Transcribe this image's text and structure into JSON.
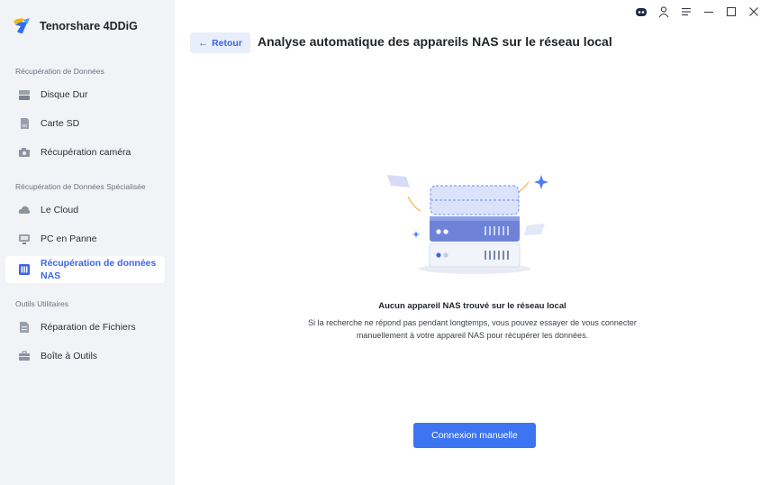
{
  "app": {
    "name": "Tenorshare 4DDiG"
  },
  "sidebar": {
    "sections": [
      {
        "title": "Récupération de Données"
      },
      {
        "title": "Récupération de Données Spécialisée"
      },
      {
        "title": "Outils Utilitaires"
      }
    ],
    "items": [
      {
        "label": "Disque Dur",
        "icon": "hard-drive-icon"
      },
      {
        "label": "Carte SD",
        "icon": "sd-card-icon"
      },
      {
        "label": "Récupération caméra",
        "icon": "camera-icon"
      },
      {
        "label": "Le Cloud",
        "icon": "cloud-icon"
      },
      {
        "label": "PC en Panne",
        "icon": "pc-icon"
      },
      {
        "label": "Récupération de données NAS",
        "icon": "nas-icon",
        "active": true
      },
      {
        "label": "Réparation de Fichiers",
        "icon": "file-repair-icon"
      },
      {
        "label": "Boîte à Outils",
        "icon": "toolbox-icon"
      }
    ]
  },
  "header": {
    "back_label": "Retour",
    "title": "Analyse automatique des appareils NAS sur le réseau local"
  },
  "empty_state": {
    "title": "Aucun appareil NAS trouvé sur le réseau local",
    "description_line1": "Si la recherche ne répond pas pendant longtemps, vous pouvez essayer de vous connecter",
    "description_line2": "manuellement à votre appareil NAS pour récupérer les données."
  },
  "actions": {
    "manual_connect_label": "Connexion manuelle"
  },
  "colors": {
    "accent": "#3d74f2",
    "sidebar_bg": "#f2f3f6",
    "active_text": "#3d66e6"
  }
}
